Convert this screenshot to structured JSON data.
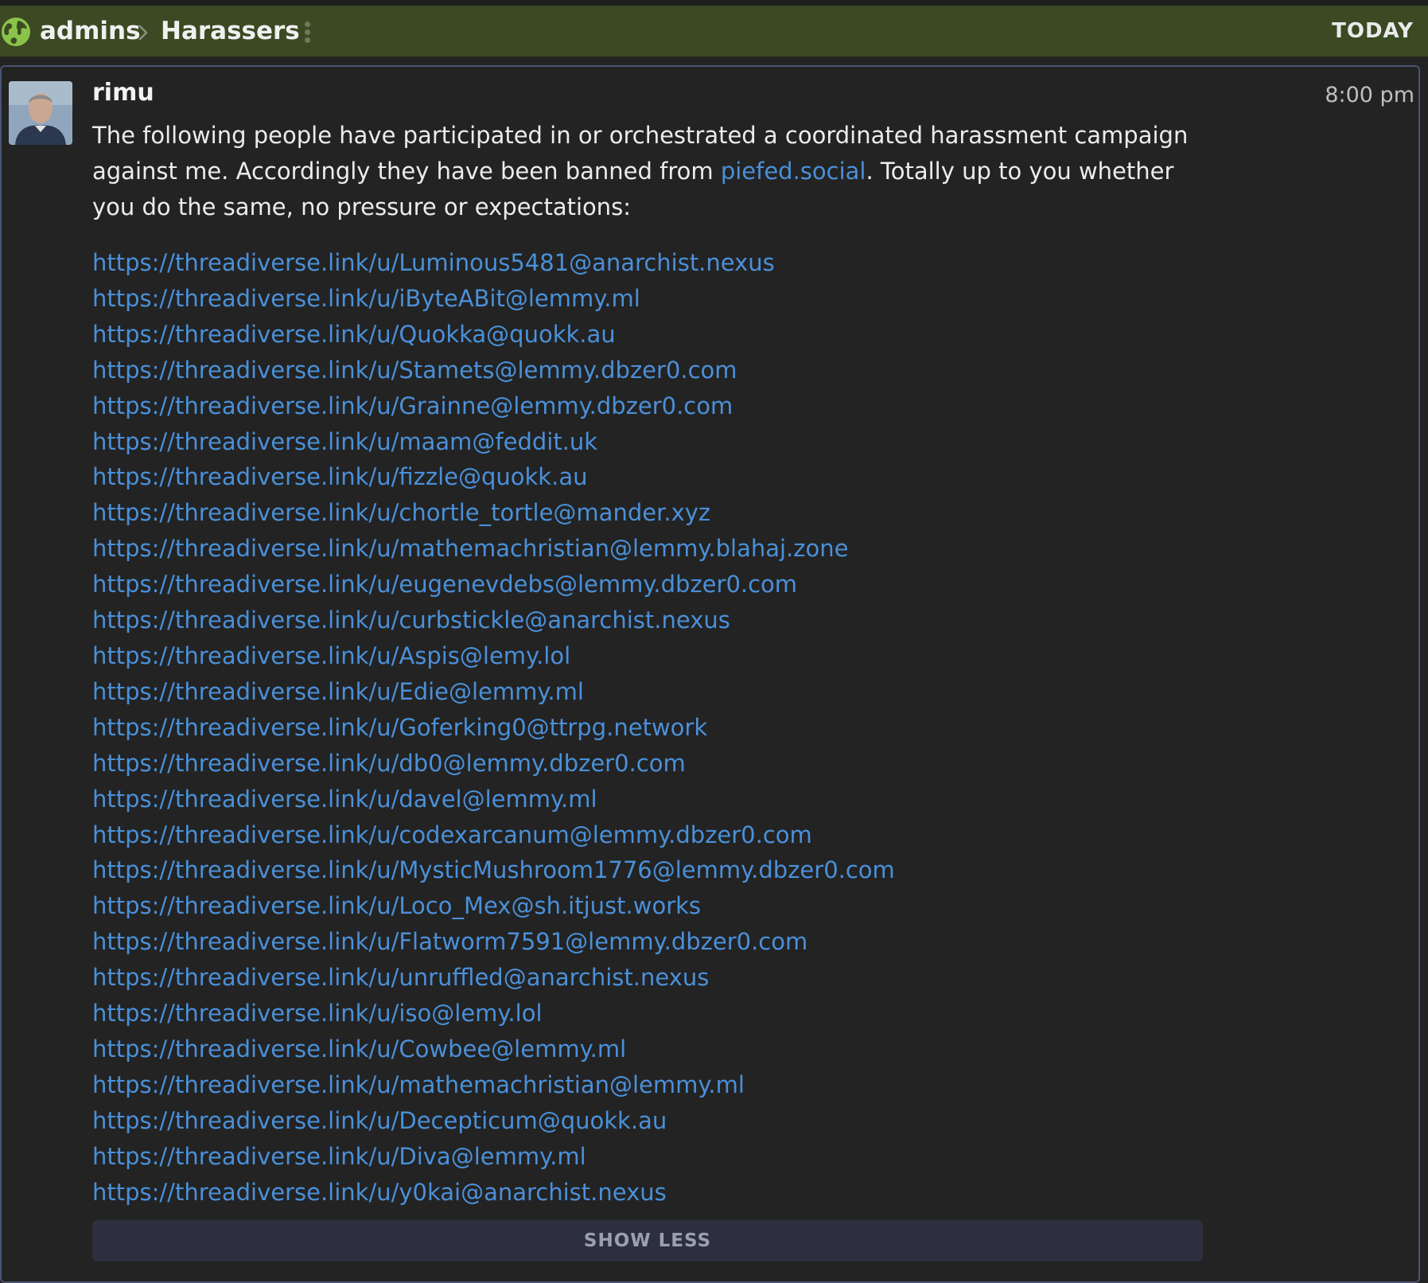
{
  "header": {
    "breadcrumb_root": "admins",
    "breadcrumb_current": "Harassers",
    "date_label": "TODAY",
    "icons": [
      "globe-icon",
      "chevron-right-icon",
      "kebab-menu-icon"
    ],
    "background_color": "#3b4a23"
  },
  "message": {
    "author": "rimu",
    "time": "8:00 pm",
    "intro_part1": "The following people have participated in or orchestrated a coordinated harassment campaign against me. Accordingly they have been banned from ",
    "intro_link": "piefed.social",
    "intro_part2": ". Totally up to you whether you do the same, no pressure or expectations:",
    "links": [
      "https://threadiverse.link/u/Luminous5481@anarchist.nexus",
      "https://threadiverse.link/u/iByteABit@lemmy.ml",
      "https://threadiverse.link/u/Quokka@quokk.au",
      "https://threadiverse.link/u/Stamets@lemmy.dbzer0.com",
      "https://threadiverse.link/u/Grainne@lemmy.dbzer0.com",
      "https://threadiverse.link/u/maam@feddit.uk",
      "https://threadiverse.link/u/fizzle@quokk.au",
      "https://threadiverse.link/u/chortle_tortle@mander.xyz",
      "https://threadiverse.link/u/mathemachristian@lemmy.blahaj.zone",
      "https://threadiverse.link/u/eugenevdebs@lemmy.dbzer0.com",
      "https://threadiverse.link/u/curbstickle@anarchist.nexus",
      "https://threadiverse.link/u/Aspis@lemy.lol",
      "https://threadiverse.link/u/Edie@lemmy.ml",
      "https://threadiverse.link/u/Goferking0@ttrpg.network",
      "https://threadiverse.link/u/db0@lemmy.dbzer0.com",
      "https://threadiverse.link/u/davel@lemmy.ml",
      "https://threadiverse.link/u/codexarcanum@lemmy.dbzer0.com",
      "https://threadiverse.link/u/MysticMushroom1776@lemmy.dbzer0.com",
      "https://threadiverse.link/u/Loco_Mex@sh.itjust.works",
      "https://threadiverse.link/u/Flatworm7591@lemmy.dbzer0.com",
      "https://threadiverse.link/u/unruffled@anarchist.nexus",
      "https://threadiverse.link/u/iso@lemy.lol",
      "https://threadiverse.link/u/Cowbee@lemmy.ml",
      "https://threadiverse.link/u/mathemachristian@lemmy.ml",
      "https://threadiverse.link/u/Decepticum@quokk.au",
      "https://threadiverse.link/u/Diva@lemmy.ml",
      "https://threadiverse.link/u/y0kai@anarchist.nexus"
    ],
    "show_less_label": "SHOW LESS",
    "link_color": "#4a90d9"
  }
}
